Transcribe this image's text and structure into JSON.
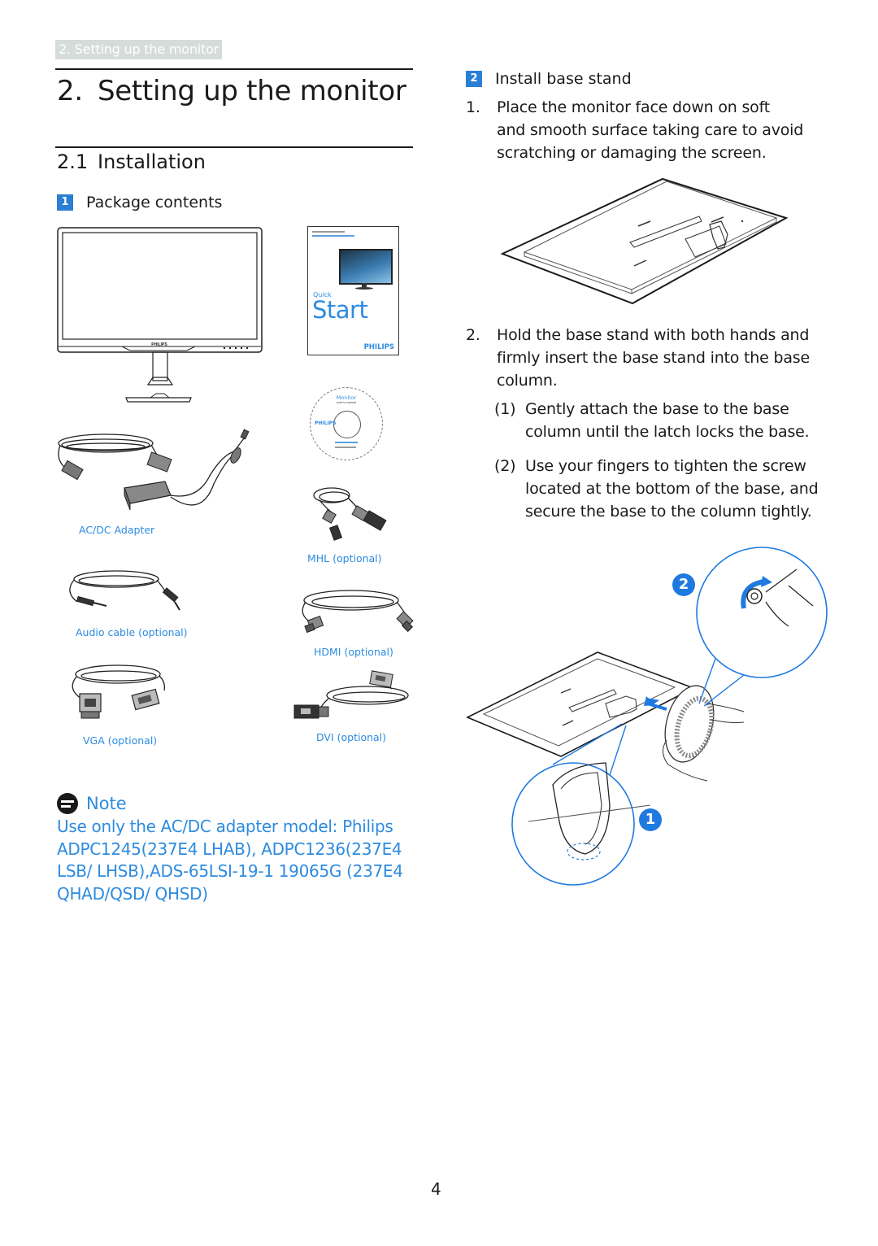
{
  "running_header": "2. Setting up the monitor",
  "chapter": {
    "number": "2.",
    "title": "Setting up the monitor"
  },
  "section": {
    "number": "2.1",
    "title": "Installation"
  },
  "step1": {
    "badge": "1",
    "title": "Package contents",
    "booklet": {
      "line1": "Quick",
      "line2": "Start",
      "brand": "PHILIPS"
    },
    "monitor_brand": "PHILIPS",
    "cd": {
      "title": "Monitor",
      "subtitle": "user's manual",
      "brand": "PHILIPS"
    },
    "items": [
      {
        "id": "acdc",
        "caption": "AC/DC Adapter"
      },
      {
        "id": "mhl",
        "caption": "MHL (optional)"
      },
      {
        "id": "audio",
        "caption": "Audio cable (optional)"
      },
      {
        "id": "hdmi",
        "caption": "HDMI (optional)"
      },
      {
        "id": "vga",
        "caption": "VGA (optional)"
      },
      {
        "id": "dvi",
        "caption": "DVI (optional)"
      }
    ]
  },
  "note": {
    "title": "Note",
    "lines": [
      "Use only the AC/DC adapter model: Philips",
      "ADPC1245(237E4 LHAB), ADPC1236(237E4",
      "LSB/ LHSB),ADS-65LSI-19-1 19065G  (237E4",
      "QHAD/QSD/ QHSD)"
    ]
  },
  "step2": {
    "badge": "2",
    "title": "Install base stand",
    "instructions": [
      {
        "marker": "1.",
        "lines": [
          "Place the monitor face down on soft",
          "and smooth surface taking care to avoid",
          "scratching or damaging the screen."
        ]
      },
      {
        "marker": "2.",
        "lines": [
          "Hold the base stand with both hands and",
          "firmly insert the base stand into the base",
          "column."
        ],
        "substeps": [
          {
            "marker": "(1)",
            "lines": [
              "Gently attach the base to the base",
              "column until the latch locks the base."
            ]
          },
          {
            "marker": "(2)",
            "lines": [
              "Use your fingers to tighten the screw",
              "located at the bottom of the base, and",
              "secure the base to the column tightly."
            ]
          }
        ]
      }
    ],
    "callouts": [
      "1",
      "2"
    ]
  },
  "colors": {
    "accent": "#2d8be0",
    "badge": "#2a7fd4",
    "header_bg": "#d5dcda",
    "callout": "#1f7ae0"
  },
  "page_number": "4"
}
